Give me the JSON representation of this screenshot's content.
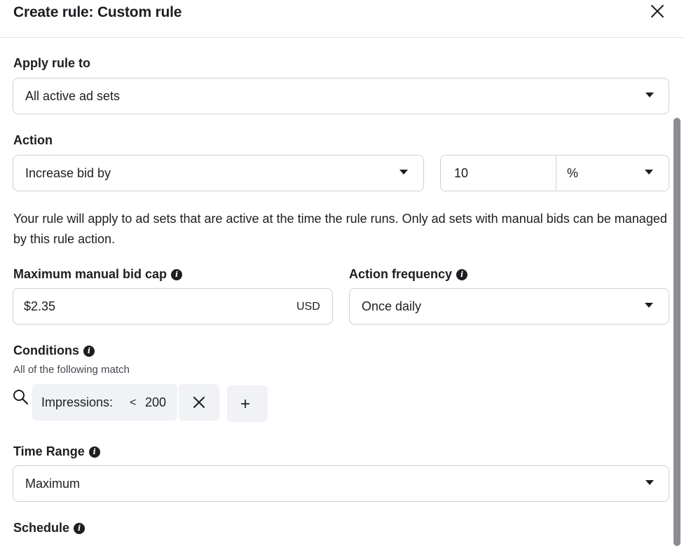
{
  "dialog": {
    "title": "Create rule: Custom rule",
    "close_icon": "close-icon"
  },
  "apply_rule": {
    "label": "Apply rule to",
    "value": "All active ad sets"
  },
  "action": {
    "label": "Action",
    "value": "Increase bid by",
    "amount": "10",
    "unit": "%"
  },
  "description": "Your rule will apply to ad sets that are active at the time the rule runs. Only ad sets with manual bids can be managed by this rule action.",
  "bid_cap": {
    "label": "Maximum manual bid cap",
    "value": "$2.35",
    "currency": "USD"
  },
  "frequency": {
    "label": "Action frequency",
    "value": "Once daily"
  },
  "conditions": {
    "label": "Conditions",
    "subtitle": "All of the following match",
    "chip_metric": "Impressions:",
    "chip_operator": "<",
    "chip_value": "200",
    "add_label": "+"
  },
  "time_range": {
    "label": "Time Range",
    "value": "Maximum"
  },
  "schedule": {
    "label": "Schedule"
  },
  "info_glyph": "i"
}
